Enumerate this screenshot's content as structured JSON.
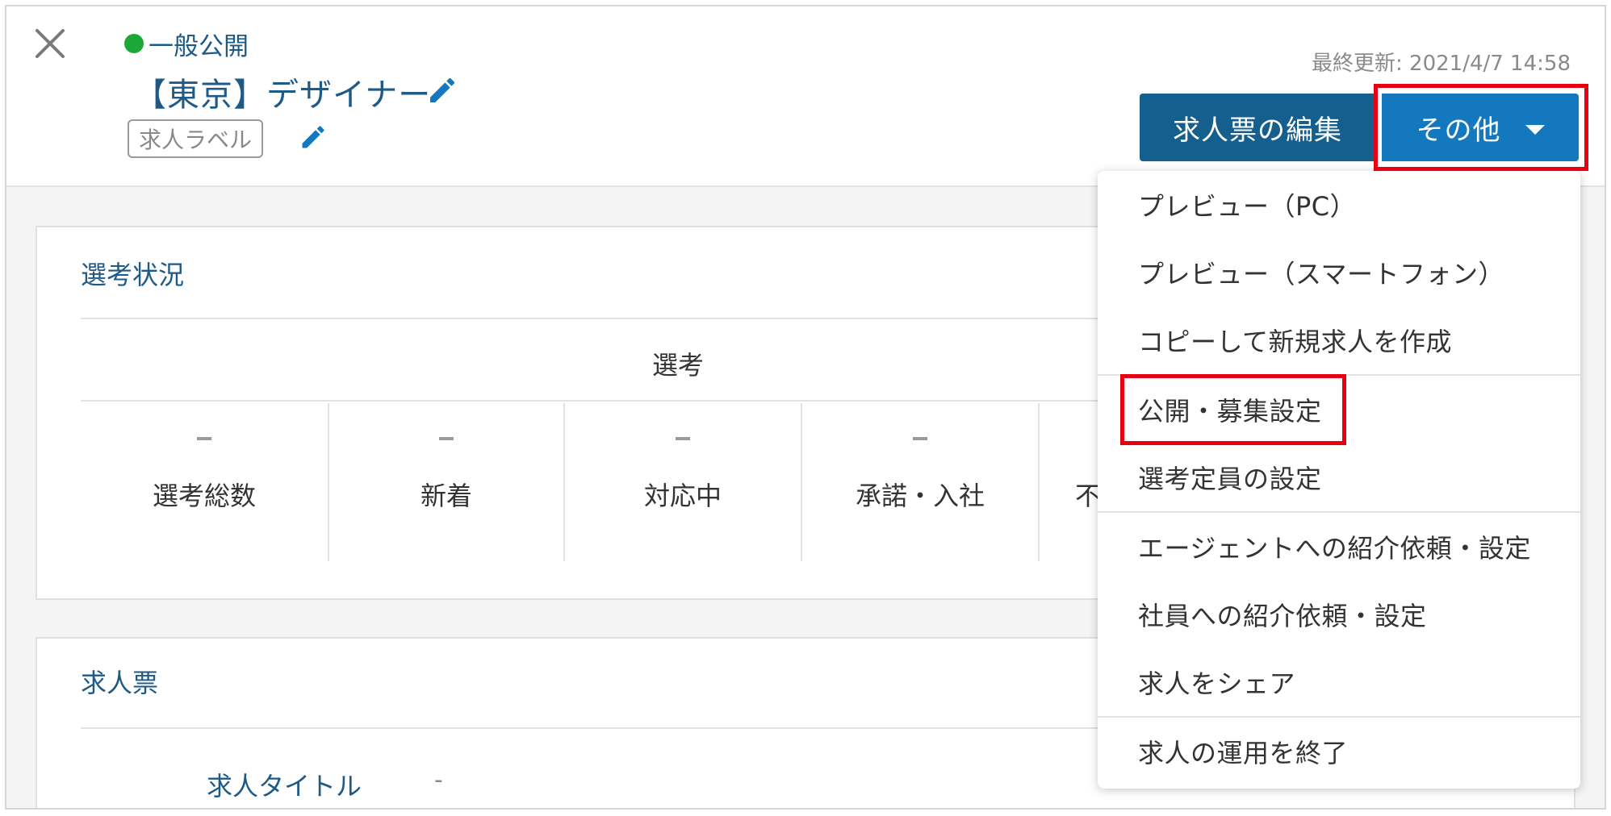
{
  "header": {
    "status_text": "一般公開",
    "status_color": "#1ca838",
    "job_title": "【東京】デザイナー",
    "label_tag": "求人ラベル",
    "last_updated": "最終更新: 2021/4/7 14:58",
    "edit_job_button": "求人票の編集",
    "other_button": "その他"
  },
  "selection_card": {
    "title": "選考状況",
    "table_header": "選考",
    "stats": [
      {
        "label": "選考総数",
        "value": "-"
      },
      {
        "label": "新着",
        "value": "-"
      },
      {
        "label": "対応中",
        "value": "-"
      },
      {
        "label": "承諾・入社",
        "value": "-"
      },
      {
        "label": "不",
        "value": ""
      }
    ]
  },
  "job_sheet_card": {
    "title": "求人票",
    "row_label": "求人タイトル",
    "row_value": "-"
  },
  "dropdown": {
    "items": [
      "プレビュー（PC）",
      "プレビュー（スマートフォン）",
      "コピーして新規求人を作成",
      "公開・募集設定",
      "選考定員の設定",
      "エージェントへの紹介依頼・設定",
      "社員への紹介依頼・設定",
      "求人をシェア",
      "求人の運用を終了"
    ]
  },
  "colors": {
    "accent": "#1e5a87",
    "primary_button": "#155f8e",
    "secondary_button": "#1478bf",
    "highlight": "#e60012"
  },
  "icons": {
    "close": "close-icon",
    "edit": "pencil-icon",
    "caret": "caret-down-icon"
  }
}
